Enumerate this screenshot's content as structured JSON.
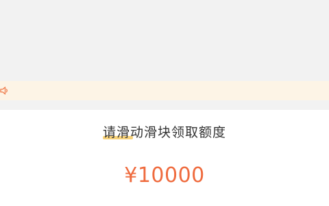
{
  "notice": {
    "icon": "speaker-icon",
    "background_color": "#fdf4e6",
    "icon_color": "#ef7a4a"
  },
  "slider_card": {
    "instruction": "请滑动滑块领取额度",
    "amount": "¥10000",
    "amount_color": "#ef6b3e",
    "highlight_color": "#f7d27a"
  }
}
